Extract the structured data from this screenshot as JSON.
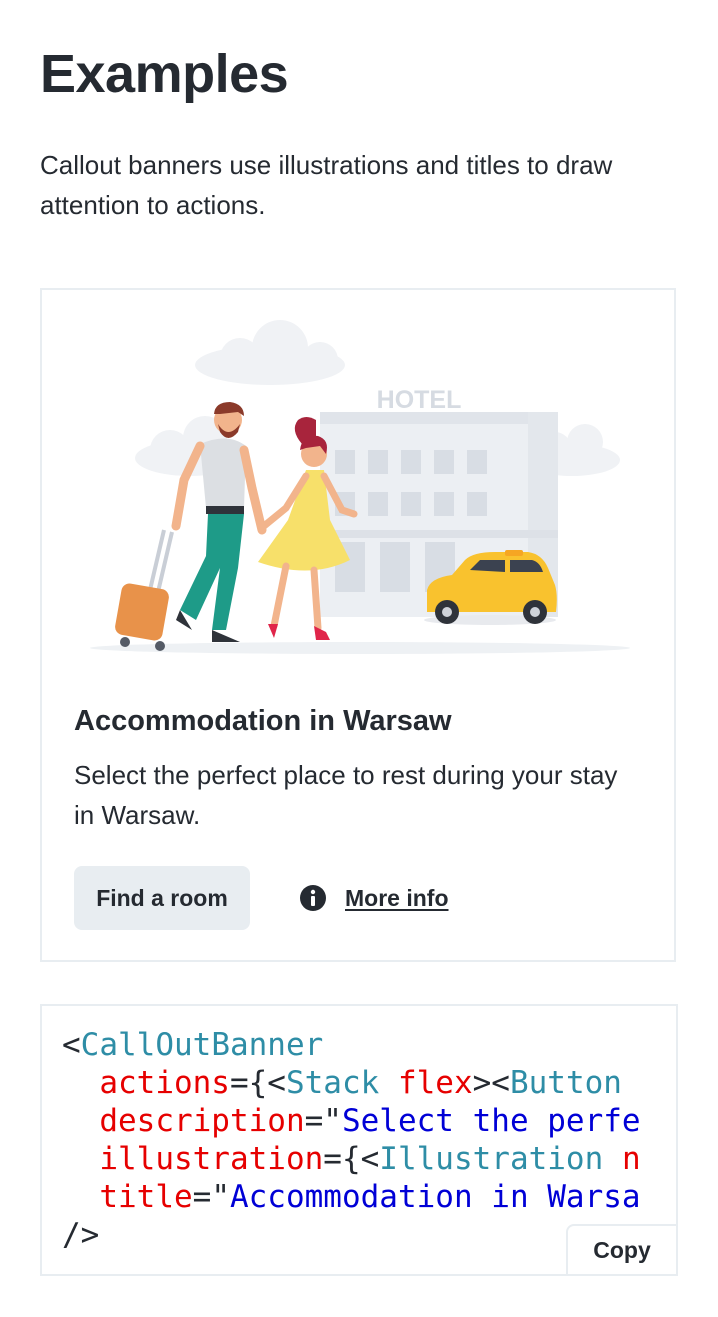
{
  "page": {
    "title": "Examples",
    "intro": "Callout banners use illustrations and titles to draw attention to actions."
  },
  "banner": {
    "illustration_sign": "HOTEL",
    "title": "Accommodation in Warsaw",
    "description": "Select the perfect place to rest during your stay in Warsaw.",
    "primary_action": "Find a room",
    "secondary_action": "More info",
    "secondary_icon": "info-circle-icon"
  },
  "code": {
    "line1_open": "<",
    "line1_tag": "CallOutBanner",
    "line2_attr": "actions",
    "line2_eq": "={<",
    "line2_tag": "Stack",
    "line2_attr2": "flex",
    "line2_mid": "><",
    "line2_tag2": "Button",
    "line3_attr": "description",
    "line3_eq": "=\"",
    "line3_str": "Select the perfe",
    "line4_attr": "illustration",
    "line4_eq": "={<",
    "line4_tag": "Illustration",
    "line4_tail": "n",
    "line5_attr": "title",
    "line5_eq": "=\"",
    "line5_str": "Accommodation in Warsa",
    "line6": "/>",
    "copy_label": "Copy"
  },
  "colors": {
    "text": "#252a31",
    "button_bg": "#e8edf1",
    "code_tag": "#2e8da6",
    "code_attr": "#e60000",
    "code_string": "#0000d6",
    "taxi": "#f9c22e"
  }
}
